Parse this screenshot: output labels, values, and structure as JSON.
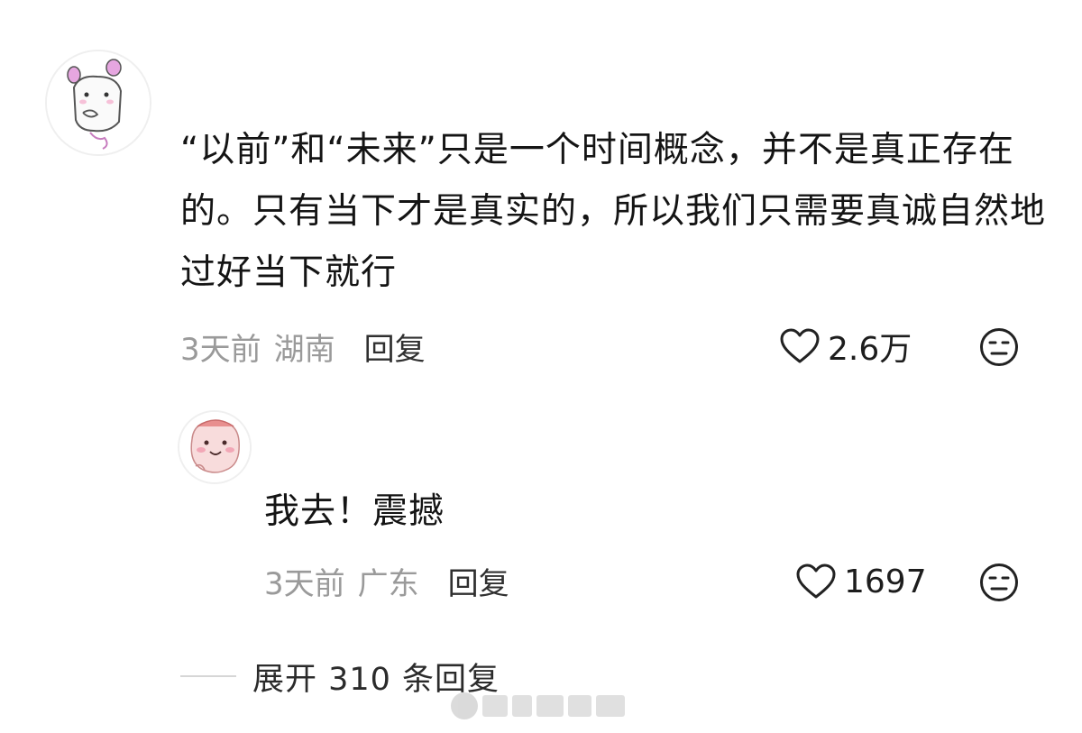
{
  "comment": {
    "avatar_icon": "cartoon-rabbit-avatar-icon",
    "text": "“以前”和“未来”只是一个时间概念，并不是真正存在的。只有当下才是真实的，所以我们只需要真诚自然地过好当下就行",
    "time": "3天前",
    "location": "湖南",
    "reply_label": "回复",
    "likes": "2.6万",
    "like_icon": "heart-outline-icon",
    "dislike_icon": "neutral-face-icon"
  },
  "reply": {
    "avatar_icon": "pink-character-avatar-icon",
    "text": "我去！震撼",
    "time": "3天前",
    "location": "广东",
    "reply_label": "回复",
    "likes": "1697",
    "like_icon": "heart-outline-icon",
    "dislike_icon": "neutral-face-icon"
  },
  "expand": {
    "label": "展开 310 条回复"
  },
  "colors": {
    "text_primary": "#141414",
    "text_meta": "#9a9a9a",
    "background": "#ffffff"
  }
}
